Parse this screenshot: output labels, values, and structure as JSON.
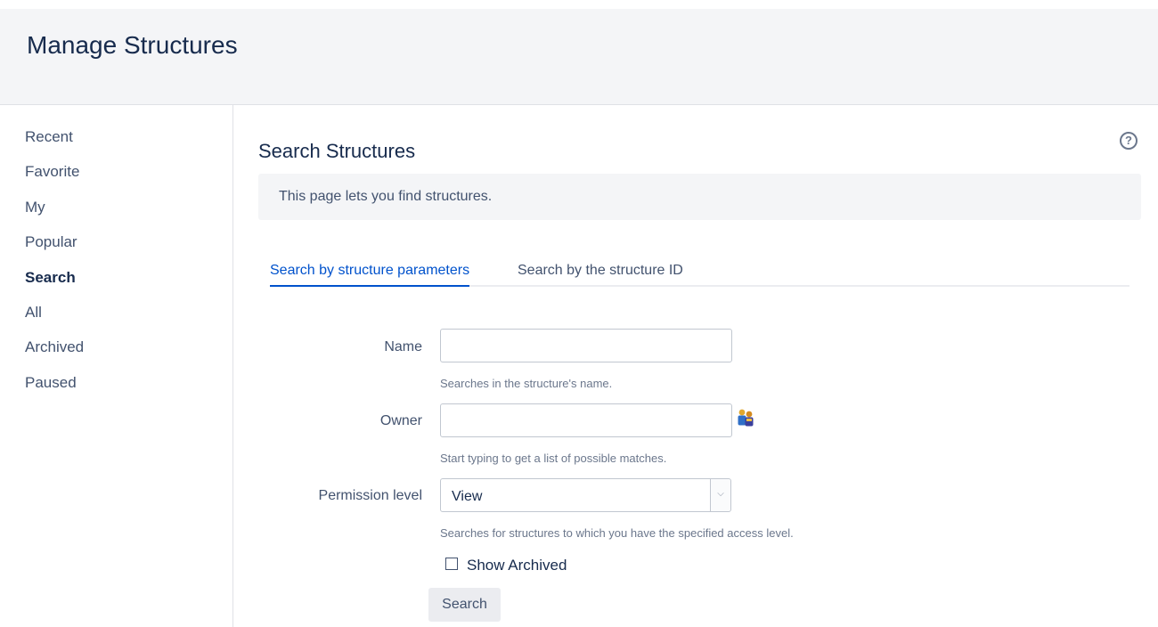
{
  "header": {
    "title": "Manage Structures"
  },
  "sidebar": {
    "items": [
      {
        "label": "Recent",
        "active": false
      },
      {
        "label": "Favorite",
        "active": false
      },
      {
        "label": "My",
        "active": false
      },
      {
        "label": "Popular",
        "active": false
      },
      {
        "label": "Search",
        "active": true
      },
      {
        "label": "All",
        "active": false
      },
      {
        "label": "Archived",
        "active": false
      },
      {
        "label": "Paused",
        "active": false
      }
    ]
  },
  "main": {
    "title": "Search Structures",
    "help_icon": "question-circle-icon",
    "info_text": "This page lets you find structures.",
    "tabs": [
      {
        "label": "Search by structure parameters",
        "active": true
      },
      {
        "label": "Search by the structure ID",
        "active": false
      }
    ],
    "form": {
      "name": {
        "label": "Name",
        "value": "",
        "hint": "Searches in the structure's name."
      },
      "owner": {
        "label": "Owner",
        "value": "",
        "hint": "Start typing to get a list of possible matches.",
        "picker_icon": "user-picker-icon"
      },
      "permission": {
        "label": "Permission level",
        "selected": "View",
        "hint": "Searches for structures to which you have the specified access level."
      },
      "show_archived": {
        "label": "Show Archived",
        "checked": false
      },
      "submit_label": "Search"
    }
  },
  "colors": {
    "accent": "#0052cc",
    "header_bg": "#f4f5f7",
    "text": "#172b4d"
  }
}
